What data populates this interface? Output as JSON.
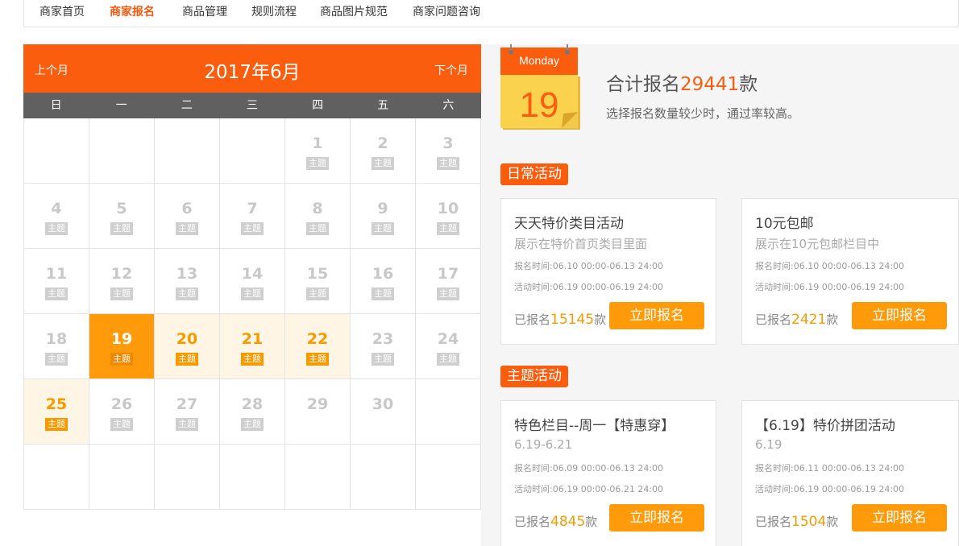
{
  "nav": {
    "items": [
      "商家首页",
      "商家报名",
      "商品管理",
      "规则流程",
      "商品图片规范",
      "商家问题咨询"
    ],
    "active_index": 1
  },
  "calendar": {
    "prev_label": "上个月",
    "next_label": "下个月",
    "title": "2017年6月",
    "weekdays": [
      "日",
      "一",
      "二",
      "三",
      "四",
      "五",
      "六"
    ],
    "tag_label": "主题",
    "cells": [
      {
        "n": ""
      },
      {
        "n": ""
      },
      {
        "n": ""
      },
      {
        "n": ""
      },
      {
        "n": "1",
        "tag": true
      },
      {
        "n": "2",
        "tag": true
      },
      {
        "n": "3",
        "tag": true
      },
      {
        "n": "4",
        "tag": true
      },
      {
        "n": "5",
        "tag": true
      },
      {
        "n": "6",
        "tag": true
      },
      {
        "n": "7",
        "tag": true
      },
      {
        "n": "8",
        "tag": true
      },
      {
        "n": "9",
        "tag": true
      },
      {
        "n": "10",
        "tag": true
      },
      {
        "n": "11",
        "tag": true
      },
      {
        "n": "12",
        "tag": true
      },
      {
        "n": "13",
        "tag": true
      },
      {
        "n": "14",
        "tag": true
      },
      {
        "n": "15",
        "tag": true
      },
      {
        "n": "16",
        "tag": true
      },
      {
        "n": "17",
        "tag": true
      },
      {
        "n": "18",
        "tag": true
      },
      {
        "n": "19",
        "tag": true,
        "state": "today"
      },
      {
        "n": "20",
        "tag": true,
        "state": "hot"
      },
      {
        "n": "21",
        "tag": true,
        "state": "hot"
      },
      {
        "n": "22",
        "tag": true,
        "state": "hot"
      },
      {
        "n": "23",
        "tag": true
      },
      {
        "n": "24",
        "tag": true
      },
      {
        "n": "25",
        "tag": true,
        "state": "hot"
      },
      {
        "n": "26",
        "tag": true
      },
      {
        "n": "27",
        "tag": true
      },
      {
        "n": "28",
        "tag": true
      },
      {
        "n": "29"
      },
      {
        "n": "30"
      },
      {
        "n": ""
      },
      {
        "n": ""
      },
      {
        "n": ""
      },
      {
        "n": ""
      },
      {
        "n": ""
      },
      {
        "n": ""
      },
      {
        "n": ""
      },
      {
        "n": ""
      }
    ]
  },
  "summary": {
    "icon_weekday": "Monday",
    "icon_day": "19",
    "prefix": "合计报名",
    "count": "29441",
    "suffix": "款",
    "sub": "选择报名数量较少时，通过率较高。"
  },
  "sections": [
    {
      "label": "日常活动",
      "cards": [
        {
          "title": "天天特价类目活动",
          "desc": "展示在特价首页类目里面",
          "time1": "报名时间:06.10 00:00-06.13 24:00",
          "time2": "活动时间:06.19 00:00-06.19 24:00",
          "reg_prefix": "已报名",
          "reg_count": "15145",
          "reg_suffix": "款",
          "button": "立即报名"
        },
        {
          "title": "10元包邮",
          "desc": "展示在10元包邮栏目中",
          "time1": "报名时间:06.10 00:00-06.13 24:00",
          "time2": "活动时间:06.19 00:00-06.19 24:00",
          "reg_prefix": "已报名",
          "reg_count": "2421",
          "reg_suffix": "款",
          "button": "立即报名"
        }
      ]
    },
    {
      "label": "主题活动",
      "cards": [
        {
          "title": "特色栏目--周一【特惠穿】",
          "desc": "6.19-6.21",
          "time1": "报名时间:06.09 00:00-06.13 24:00",
          "time2": "活动时间:06.19 00:00-06.21 24:00",
          "reg_prefix": "已报名",
          "reg_count": "4845",
          "reg_suffix": "款",
          "button": "立即报名"
        },
        {
          "title": "【6.19】特价拼团活动",
          "desc": "6.19",
          "time1": "报名时间:06.11 00:00-06.13 24:00",
          "time2": "活动时间:06.19 00:00-06.19 24:00",
          "reg_prefix": "已报名",
          "reg_count": "1504",
          "reg_suffix": "款",
          "button": "立即报名"
        }
      ]
    }
  ],
  "colors": {
    "accent": "#fb5d0e",
    "orange": "#ff9a0a",
    "icon_yellow": "#fbd24e"
  }
}
